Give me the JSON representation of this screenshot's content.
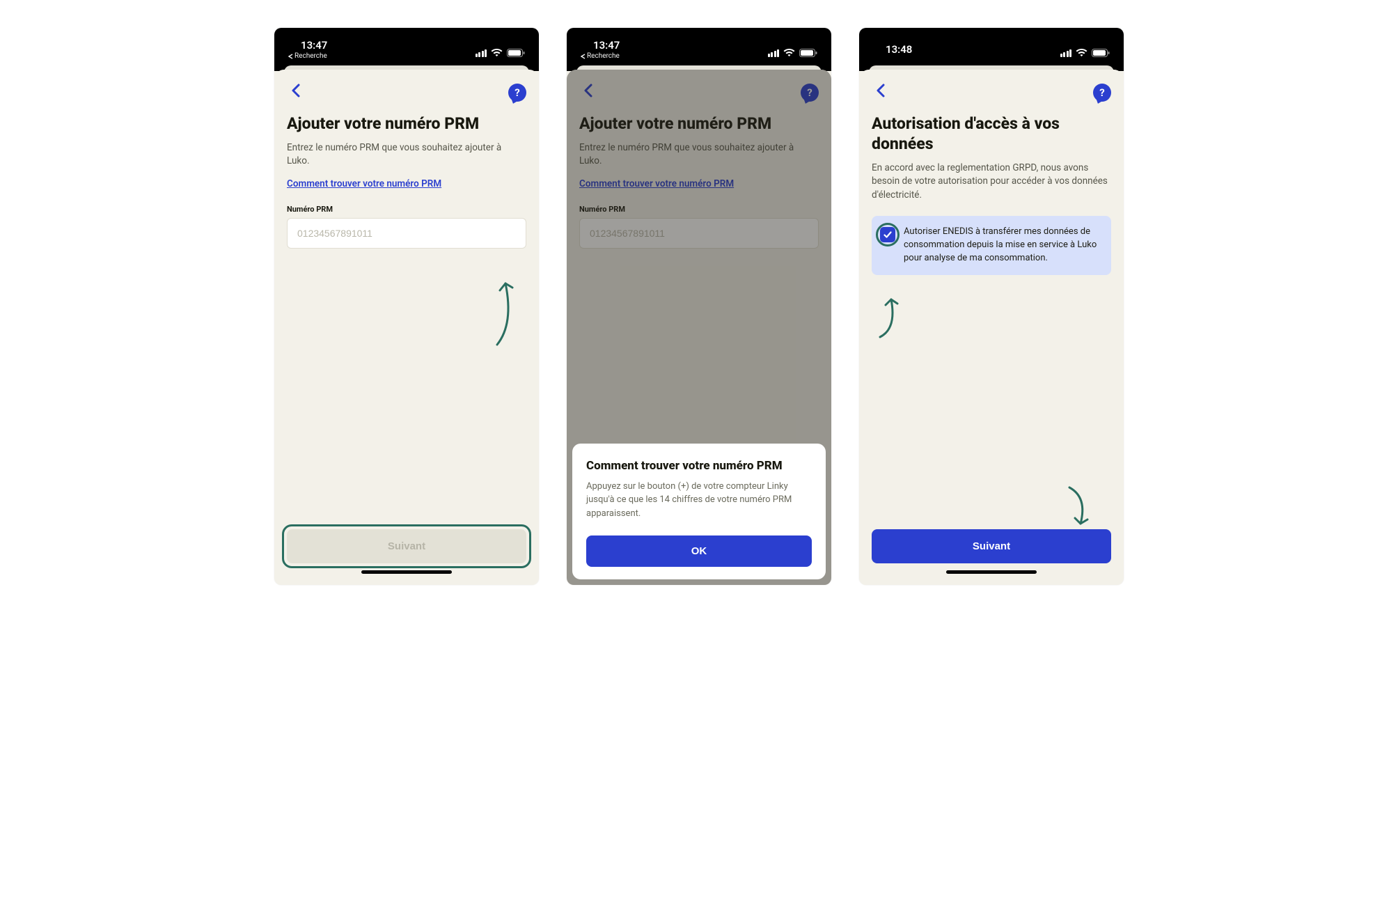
{
  "screens": [
    {
      "status": {
        "time": "13:47",
        "back_app": "Recherche"
      },
      "title": "Ajouter votre numéro PRM",
      "subtitle": "Entrez le numéro PRM que vous souhaitez ajouter à Luko.",
      "help_link": "Comment trouver votre numéro PRM",
      "field_label": "Numéro PRM",
      "input_placeholder": "01234567891011",
      "next_label": "Suivant"
    },
    {
      "status": {
        "time": "13:47",
        "back_app": "Recherche"
      },
      "title": "Ajouter votre numéro PRM",
      "subtitle": "Entrez le numéro PRM que vous souhaitez ajouter à Luko.",
      "help_link": "Comment trouver votre numéro PRM",
      "field_label": "Numéro PRM",
      "input_placeholder": "01234567891011",
      "modal": {
        "title": "Comment trouver votre numéro PRM",
        "body": "Appuyez sur le bouton (+) de votre compteur Linky jusqu'à ce que les 14 chiffres de votre numéro PRM apparaissent.",
        "ok": "OK"
      }
    },
    {
      "status": {
        "time": "13:48"
      },
      "title": "Autorisation d'accès à vos données",
      "subtitle": "En accord avec la reglementation GRPD, nous avons besoin de votre autorisation pour accéder à vos données d'électricité.",
      "consent_text": "Autoriser ENEDIS à transférer mes données de consommation depuis la mise en service à Luko pour analyse de ma consommation.",
      "next_label": "Suivant"
    }
  ]
}
